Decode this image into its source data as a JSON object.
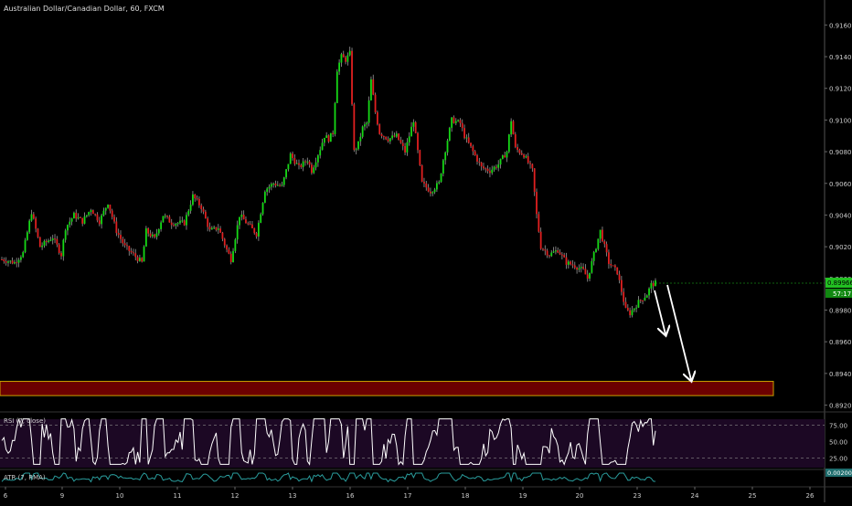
{
  "title": "Australian Dollar/Canadian Dollar, 60, FXCM",
  "rsi_label": "RSI (7, close)",
  "atr_label": "ATR (7, RMA)",
  "last_price_label": "0.89966",
  "countdown_label": "57:17",
  "colors": {
    "background": "#000000",
    "up": "#16d916",
    "down": "#e02020",
    "zone_fill": "#6b0000",
    "zone_border": "#c8a000",
    "rsi_fill": "#1c0824",
    "atr_line": "#2a9d9d",
    "price_tag": "#22c022"
  },
  "chart_data": {
    "type": "candlestick",
    "title": "Australian Dollar/Canadian Dollar, 60, FXCM",
    "x_tick_labels": [
      "6",
      "9",
      "10",
      "11",
      "12",
      "13",
      "16",
      "17",
      "18",
      "19",
      "20",
      "23",
      "24",
      "25",
      "26"
    ],
    "y_tick_labels": [
      "0.91600",
      "0.91400",
      "0.91200",
      "0.91000",
      "0.90800",
      "0.90600",
      "0.90400",
      "0.90200",
      "0.90000",
      "0.89800",
      "0.89600",
      "0.89400",
      "0.89200"
    ],
    "ylim": [
      0.8918,
      0.917
    ],
    "price_path": [
      [
        0,
        0.9012
      ],
      [
        6,
        0.901
      ],
      [
        10,
        0.9016
      ],
      [
        14,
        0.9042
      ],
      [
        18,
        0.902
      ],
      [
        24,
        0.9026
      ],
      [
        28,
        0.9015
      ],
      [
        30,
        0.9032
      ],
      [
        34,
        0.904
      ],
      [
        38,
        0.9036
      ],
      [
        42,
        0.9044
      ],
      [
        46,
        0.9036
      ],
      [
        50,
        0.9048
      ],
      [
        54,
        0.903
      ],
      [
        58,
        0.902
      ],
      [
        62,
        0.9015
      ],
      [
        66,
        0.901
      ],
      [
        68,
        0.903
      ],
      [
        72,
        0.9025
      ],
      [
        76,
        0.904
      ],
      [
        80,
        0.9035
      ],
      [
        86,
        0.9035
      ],
      [
        90,
        0.9052
      ],
      [
        94,
        0.9045
      ],
      [
        98,
        0.903
      ],
      [
        102,
        0.9032
      ],
      [
        106,
        0.9018
      ],
      [
        108,
        0.9012
      ],
      [
        112,
        0.904
      ],
      [
        116,
        0.9034
      ],
      [
        120,
        0.9028
      ],
      [
        124,
        0.9056
      ],
      [
        128,
        0.906
      ],
      [
        132,
        0.9058
      ],
      [
        136,
        0.9078
      ],
      [
        140,
        0.907
      ],
      [
        144,
        0.9075
      ],
      [
        146,
        0.9068
      ],
      [
        150,
        0.9082
      ],
      [
        152,
        0.909
      ],
      [
        154,
        0.9088
      ],
      [
        156,
        0.9092
      ],
      [
        158,
        0.9132
      ],
      [
        160,
        0.914
      ],
      [
        162,
        0.9138
      ],
      [
        164,
        0.9142
      ],
      [
        166,
        0.908
      ],
      [
        168,
        0.9085
      ],
      [
        170,
        0.9095
      ],
      [
        172,
        0.9098
      ],
      [
        174,
        0.9125
      ],
      [
        176,
        0.9105
      ],
      [
        178,
        0.9092
      ],
      [
        182,
        0.9088
      ],
      [
        186,
        0.909
      ],
      [
        190,
        0.908
      ],
      [
        194,
        0.91
      ],
      [
        198,
        0.906
      ],
      [
        202,
        0.9055
      ],
      [
        206,
        0.906
      ],
      [
        208,
        0.9075
      ],
      [
        212,
        0.91
      ],
      [
        216,
        0.9098
      ],
      [
        218,
        0.909
      ],
      [
        222,
        0.908
      ],
      [
        226,
        0.907
      ],
      [
        230,
        0.9068
      ],
      [
        234,
        0.9072
      ],
      [
        238,
        0.908
      ],
      [
        240,
        0.91
      ],
      [
        242,
        0.9082
      ],
      [
        246,
        0.9078
      ],
      [
        250,
        0.9068
      ],
      [
        252,
        0.904
      ],
      [
        254,
        0.902
      ],
      [
        258,
        0.9015
      ],
      [
        262,
        0.9018
      ],
      [
        266,
        0.901
      ],
      [
        270,
        0.9008
      ],
      [
        274,
        0.9005
      ],
      [
        276,
        0.9
      ],
      [
        280,
        0.902
      ],
      [
        282,
        0.903
      ],
      [
        286,
        0.901
      ],
      [
        290,
        0.9004
      ],
      [
        292,
        0.8992
      ],
      [
        294,
        0.898
      ],
      [
        296,
        0.8978
      ],
      [
        300,
        0.8985
      ],
      [
        304,
        0.899
      ],
      [
        306,
        0.8996
      ],
      [
        308,
        0.8997
      ]
    ],
    "support_zone": [
      0.8926,
      0.8935
    ],
    "rsi": {
      "label": "RSI (7, close)",
      "levels": [
        75.0,
        50.0,
        25.0
      ],
      "ylim": [
        10,
        90
      ]
    },
    "atr": {
      "label": "ATR (7, RMA)",
      "value_label": "0.00200"
    }
  }
}
